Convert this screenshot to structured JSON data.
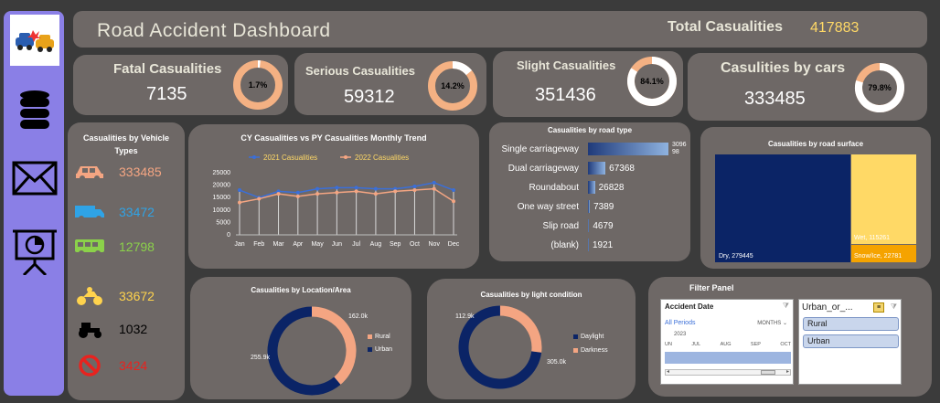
{
  "header": {
    "title": "Road Accident Dashboard",
    "total_label": "Total Casualities",
    "total_value": "417883"
  },
  "sidebar": {
    "items": [
      {
        "icon": "car-crash-icon"
      },
      {
        "icon": "database-icon"
      },
      {
        "icon": "mail-icon"
      },
      {
        "icon": "presentation-chart-icon"
      }
    ]
  },
  "kpis": [
    {
      "title_a": "Fatal",
      "title_b": "Casualities",
      "value": "7135",
      "pct_label": "1.7%",
      "pct": 0.017
    },
    {
      "title_a": "Serious",
      "title_b": "Casualities",
      "value": "59312",
      "pct_label": "14.2%",
      "pct": 0.142
    },
    {
      "title_a": "Slight",
      "title_b": "Casualities",
      "value": "351436",
      "pct_label": "84.1%",
      "pct": 0.841
    },
    {
      "title_a": "Casulities",
      "title_b": "by cars",
      "value": "333485",
      "pct_label": "79.8%",
      "pct": 0.798
    }
  ],
  "vehicle_types": {
    "title": "Casualities by Vehicle Types",
    "items": [
      {
        "icon": "car-icon",
        "value": "333485",
        "color": "#f4a582"
      },
      {
        "icon": "van-icon",
        "value": "33472",
        "color": "#2fa3e6"
      },
      {
        "icon": "bus-icon",
        "value": "12798",
        "color": "#8bd14a"
      },
      {
        "icon": "motorcycle-icon",
        "value": "33672",
        "color": "#ffd34d"
      },
      {
        "icon": "tractor-icon",
        "value": "1032",
        "color": "#000000"
      },
      {
        "icon": "prohibited-icon",
        "value": "3424",
        "color": "#e8231f"
      }
    ]
  },
  "monthly_trend": {
    "title": "CY Casualities vs PY Casualities Monthly Trend",
    "legend": [
      "2021 Casualities",
      "2022 Casualities"
    ]
  },
  "road_type": {
    "title": "Casualities by road type"
  },
  "road_surface": {
    "title": "Casualities by road surface",
    "labels": [
      "Dry, 279445",
      "Wet, 115261",
      "Snow/Ice, 22781"
    ]
  },
  "location": {
    "title": "Casualities by Location/Area",
    "legend": [
      "Rural",
      "Urban"
    ],
    "data_labels": [
      "162.0k",
      "255.9k"
    ]
  },
  "light": {
    "title": "Casualities by light condition",
    "legend": [
      "Daylight",
      "Darkness"
    ],
    "data_labels": [
      "112.9k",
      "305.0k"
    ]
  },
  "filter_panel": {
    "title": "Filter Panel",
    "date_slicer": {
      "header": "Accident Date",
      "all_periods": "All Periods",
      "months_label": "MONTHS",
      "year": "2023",
      "months": [
        "UN",
        "JUL",
        "AUG",
        "SEP",
        "OCT"
      ]
    },
    "area_slicer": {
      "header": "Urban_or_...",
      "options": [
        "Rural",
        "Urban"
      ]
    }
  },
  "chart_data": [
    {
      "type": "line",
      "title": "CY Casualities vs PY Casualities Monthly Trend",
      "categories": [
        "Jan",
        "Feb",
        "Mar",
        "Apr",
        "May",
        "Jun",
        "Jul",
        "Aug",
        "Sep",
        "Oct",
        "Nov",
        "Dec"
      ],
      "ylim": [
        0,
        25000
      ],
      "yticks": [
        0,
        5000,
        10000,
        15000,
        20000,
        25000
      ],
      "series": [
        {
          "name": "2021 Casualities",
          "color": "#3b6fd8",
          "values": [
            18000,
            15000,
            17500,
            17000,
            18500,
            19000,
            19000,
            18500,
            18500,
            19500,
            21000,
            18000
          ]
        },
        {
          "name": "2022 Casualities",
          "color": "#f4a582",
          "values": [
            13000,
            14500,
            16500,
            15500,
            16500,
            17000,
            17500,
            16500,
            17500,
            18000,
            18500,
            13500
          ]
        }
      ]
    },
    {
      "type": "bar",
      "title": "Casualities by road type",
      "categories": [
        "Single carriageway",
        "Dual carriageway",
        "Roundabout",
        "One way street",
        "Slip road",
        "(blank)"
      ],
      "values": [
        309698,
        67368,
        26828,
        7389,
        4679,
        1921
      ],
      "value_labels": [
        "3096\n98",
        "67368",
        "26828",
        "7389",
        "4679",
        "1921"
      ]
    },
    {
      "type": "heatmap",
      "title": "Casualities by road surface",
      "categories": [
        "Dry",
        "Wet",
        "Snow/Ice"
      ],
      "values": [
        279445,
        115261,
        22781
      ],
      "colors": [
        "#0b2466",
        "#ffd966",
        "#f5a300"
      ]
    },
    {
      "type": "pie",
      "title": "Casualities by Location/Area",
      "categories": [
        "Rural",
        "Urban"
      ],
      "values": [
        162.0,
        255.9
      ],
      "colors": [
        "#f4a582",
        "#0b2466"
      ]
    },
    {
      "type": "pie",
      "title": "Casualities by light condition",
      "categories": [
        "Daylight",
        "Darkness"
      ],
      "values": [
        305.0,
        112.9
      ],
      "colors": [
        "#0b2466",
        "#f4a582"
      ]
    }
  ]
}
